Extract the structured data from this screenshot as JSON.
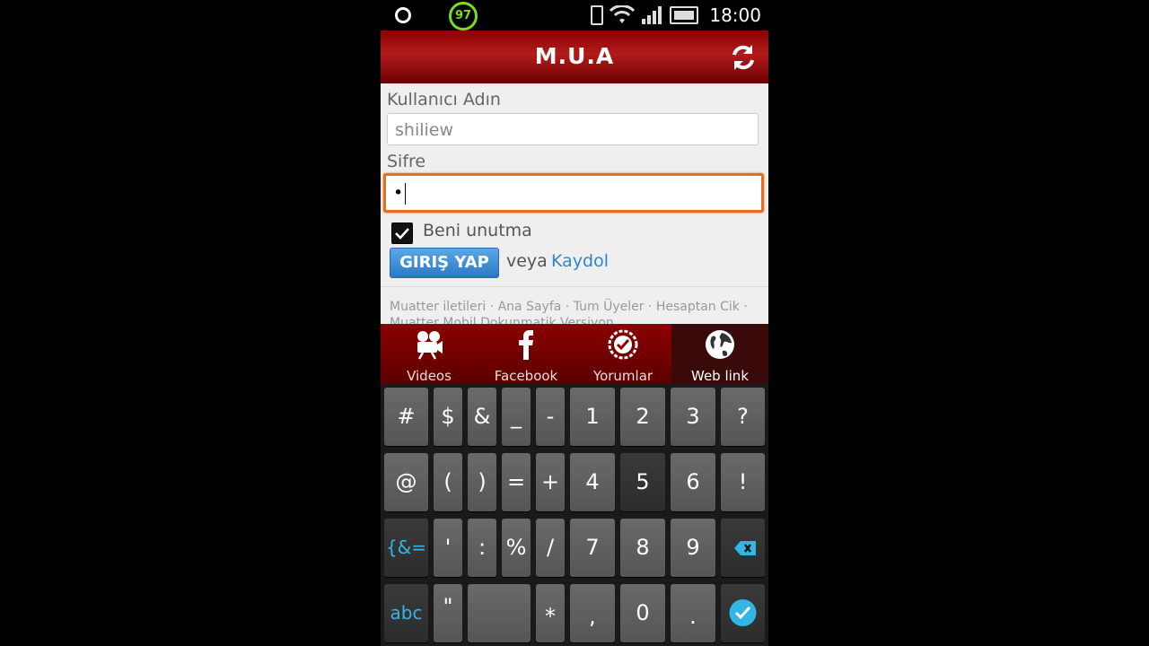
{
  "status_bar": {
    "battery_badge": "97",
    "time": "18:00"
  },
  "app_bar": {
    "title": "M.U.A"
  },
  "form": {
    "username_label": "Kullanıcı Adın",
    "username_value": "shiliew",
    "password_label": "Sifre",
    "password_value": "•",
    "remember_label": "Beni unutma",
    "remember_checked": true,
    "login_button": "GIRIŞ YAP",
    "or_text": "veya",
    "register_link": "Kaydol"
  },
  "footer_links": "Muatter iletileri · Ana Sayfa · Tum Üyeler · Hesaptan Cik · Muatter Mobil Dokunmatik Versiyon",
  "tabs": [
    {
      "label": "Videos",
      "icon": "video-camera-icon"
    },
    {
      "label": "Facebook",
      "icon": "facebook-icon"
    },
    {
      "label": "Yorumlar",
      "icon": "badge-check-icon"
    },
    {
      "label": "Web link",
      "icon": "globe-icon",
      "active": true
    }
  ],
  "keyboard": {
    "row1": [
      "#",
      "$",
      "&",
      "_",
      "-",
      "1",
      "2",
      "3",
      "?"
    ],
    "row2": [
      "@",
      "(",
      ")",
      "=",
      "+",
      "4",
      "5",
      "6",
      "!"
    ],
    "row3": [
      "{&=",
      "'",
      ":",
      "%",
      "/",
      "7",
      "8",
      "9"
    ],
    "row4": [
      "abc",
      "\"",
      "*",
      ",",
      "0",
      "."
    ]
  },
  "colors": {
    "app_bar": "#8b0000",
    "focus_border": "#e4701e",
    "link": "#2e86c8",
    "key_accent": "#33b5e5"
  }
}
